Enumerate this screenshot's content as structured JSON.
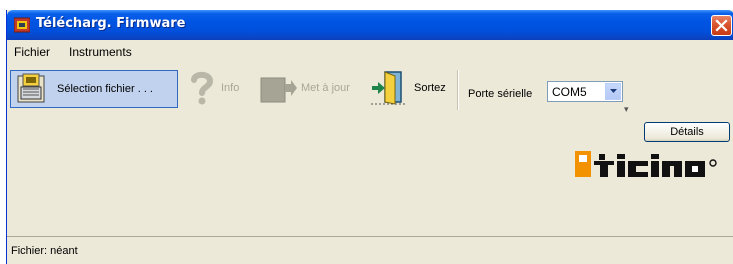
{
  "window": {
    "title": "Télécharg. Firmware",
    "icon": "bticino-app-icon",
    "close_icon": "close-icon"
  },
  "menu": {
    "items": [
      "Fichier",
      "Instruments"
    ]
  },
  "toolbar": {
    "select_file": {
      "label": "Sélection fichier . . .",
      "icon": "file-chip-icon",
      "state": "active"
    },
    "info": {
      "label": "Info",
      "icon": "question-icon",
      "state": "disabled"
    },
    "update": {
      "label": "Met à jour",
      "icon": "update-device-icon",
      "state": "disabled"
    },
    "exit": {
      "label": "Sortez",
      "icon": "exit-door-icon",
      "state": "enabled"
    },
    "port_label": "Porte sérielle",
    "port_value": "COM5"
  },
  "main": {
    "details_label": "Détails",
    "logo_text": "bticino"
  },
  "status": {
    "text": "Fichier: néant"
  },
  "colors": {
    "titlebar": "#0054e3",
    "window_bg": "#ece9d8",
    "active_button_bg": "#c1d2ee",
    "logo_orange": "#f39200"
  }
}
